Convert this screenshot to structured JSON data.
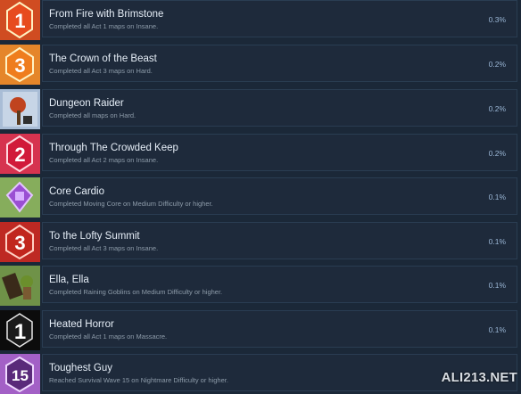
{
  "achievements": [
    {
      "title": "From Fire with Brimstone",
      "desc": "Completed all Act 1 maps on Insane.",
      "pct": "0.3%",
      "icon": "flame-badge-1-icon",
      "glyph": "1",
      "bg": "#b7271d",
      "bg2": "#f07a26",
      "fg": "#ffffff"
    },
    {
      "title": "The Crown of the Beast",
      "desc": "Completed all Act 3 maps on Hard.",
      "pct": "0.2%",
      "icon": "crown-badge-3-icon",
      "glyph": "3",
      "bg": "#d86a1a",
      "bg2": "#f7b041",
      "fg": "#ffffff"
    },
    {
      "title": "Dungeon Raider",
      "desc": "Completed all maps on Hard.",
      "pct": "0.2%",
      "icon": "dungeon-raider-icon",
      "glyph": "",
      "bg": "#a9bdd6",
      "bg2": "#e6edf6",
      "fg": "#c0431e"
    },
    {
      "title": "Through The Crowded Keep",
      "desc": "Completed all Act 2 maps on Insane.",
      "pct": "0.2%",
      "icon": "keep-badge-2-icon",
      "glyph": "2",
      "bg": "#c7152f",
      "bg2": "#ef6a8a",
      "fg": "#ffffff"
    },
    {
      "title": "Core Cardio",
      "desc": "Completed Moving Core on Medium Difficulty or higher.",
      "pct": "0.1%",
      "icon": "moving-core-icon",
      "glyph": "",
      "bg": "#5d8c3e",
      "bg2": "#b9d680",
      "fg": "#9a4fd3"
    },
    {
      "title": "To the Lofty Summit",
      "desc": "Completed all Act 3 maps on Insane.",
      "pct": "0.1%",
      "icon": "summit-badge-3-icon",
      "glyph": "3",
      "bg": "#a3171c",
      "bg2": "#e5452e",
      "fg": "#ffffff"
    },
    {
      "title": "Ella, Ella",
      "desc": "Completed Raining Goblins on Medium Difficulty or higher.",
      "pct": "0.1%",
      "icon": "raining-goblins-icon",
      "glyph": "",
      "bg": "#4b6a2c",
      "bg2": "#9cc36a",
      "fg": "#3a2a1a"
    },
    {
      "title": "Heated Horror",
      "desc": "Completed all Act 1 maps on Massacre.",
      "pct": "0.1%",
      "icon": "massacre-badge-1-icon",
      "glyph": "1",
      "bg": "#0c0c0c",
      "bg2": "#2c2222",
      "fg": "#ffffff"
    },
    {
      "title": "Toughest Guy",
      "desc": "Reached Survival Wave 15 on Nightmare Difficulty or higher.",
      "pct": "",
      "icon": "survival-wave-15-icon",
      "glyph": "15",
      "bg": "#7f3aa9",
      "bg2": "#cf8ee8",
      "fg": "#ffffff"
    }
  ],
  "watermark": "ALI213.NET"
}
